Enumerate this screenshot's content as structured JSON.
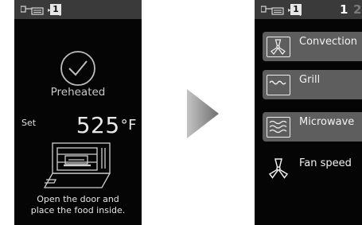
{
  "left_screen": {
    "status_badge": "1",
    "preheated_label": "Preheated",
    "set_label": "Set",
    "temperature": "525",
    "temperature_unit": "°F",
    "instruction_line1": "Open the door and",
    "instruction_line2": "place the food inside."
  },
  "right_screen": {
    "status_badge": "1",
    "page_current": "1",
    "page_next": "2",
    "modes": [
      {
        "label": "Convection",
        "icon": "fan-icon"
      },
      {
        "label": "Grill",
        "icon": "grill-icon"
      },
      {
        "label": "Microwave",
        "icon": "microwave-icon"
      }
    ],
    "fan_speed_label": "Fan speed",
    "fan_speed_icon": "fan-icon"
  },
  "transition_icon": "arrow-right-icon",
  "colors": {
    "screen_background": "#050505",
    "status_bar": "#3a3a3a",
    "button_background": "#5e5e5e",
    "page_current": "#ffffff",
    "page_next": "#7a7a7a"
  }
}
